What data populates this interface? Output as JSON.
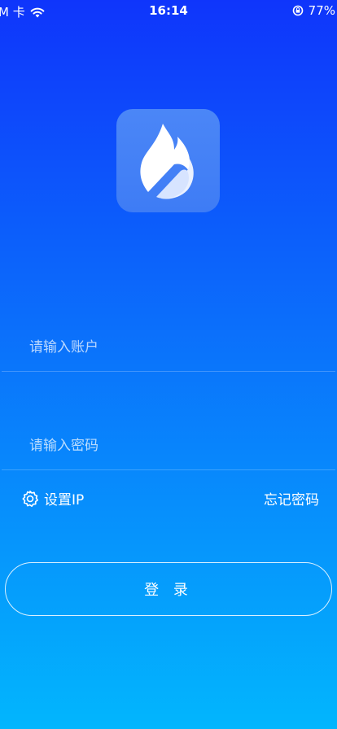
{
  "status_bar": {
    "carrier": "M 卡",
    "time": "16:14",
    "battery": "77%"
  },
  "icons": {
    "wifi": "wifi-icon",
    "rotation_lock": "rotation-lock-icon",
    "logo": "flame-logo-icon",
    "gear": "gear-icon"
  },
  "colors": {
    "gradient_top": "#0f35fb",
    "gradient_bottom": "#02b6fd",
    "logo_tile": "#4b86f7"
  },
  "form": {
    "account_placeholder": "请输入账户",
    "password_placeholder": "请输入密码",
    "set_ip_label": "设置IP",
    "forgot_password_label": "忘记密码",
    "login_label": "登 录"
  }
}
